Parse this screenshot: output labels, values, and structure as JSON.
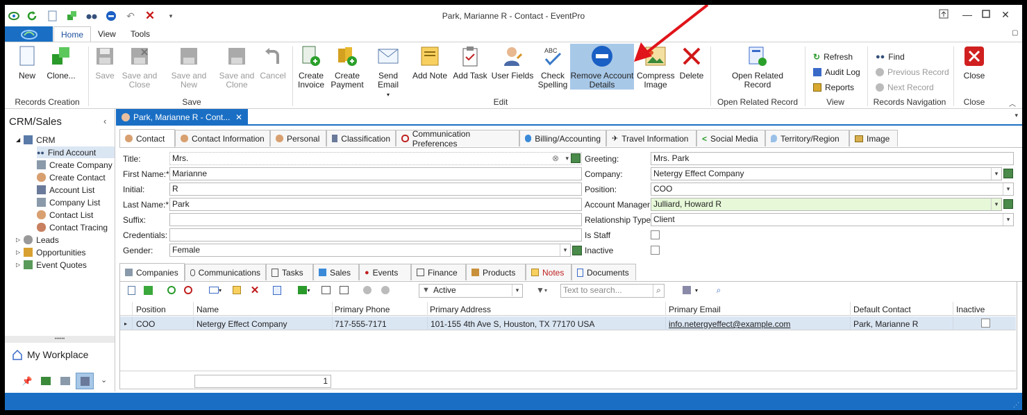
{
  "window": {
    "title": "Park, Marianne R - Contact - EventPro",
    "controls": [
      "restore-app-icon",
      "minimize-icon",
      "maximize-icon",
      "close-icon"
    ]
  },
  "ribbon_tabs": [
    {
      "label": "Home",
      "active": true
    },
    {
      "label": "View"
    },
    {
      "label": "Tools"
    }
  ],
  "ribbon": {
    "records_creation": {
      "group": "Records Creation",
      "new": "New",
      "clone": "Clone..."
    },
    "save": {
      "group": "Save",
      "save": "Save",
      "save_close_1": "Save and",
      "save_close_2": "Close",
      "save_new": "Save and New",
      "save_clone_1": "Save and",
      "save_clone_2": "Clone",
      "cancel": "Cancel"
    },
    "edit": {
      "group": "Edit",
      "create_invoice_1": "Create",
      "create_invoice_2": "Invoice",
      "create_payment_1": "Create",
      "create_payment_2": "Payment",
      "send_email": "Send Email",
      "add_note": "Add Note",
      "add_task": "Add Task",
      "user_fields": "User Fields",
      "check_spelling_1": "Check",
      "check_spelling_2": "Spelling",
      "remove_account_1": "Remove Account",
      "remove_account_2": "Details",
      "compress_image_1": "Compress",
      "compress_image_2": "Image",
      "delete": "Delete"
    },
    "open_related": {
      "group": "Open Related Record",
      "label_1": "Open Related",
      "label_2": "Record"
    },
    "view": {
      "group": "View",
      "refresh": "Refresh",
      "audit_log": "Audit Log",
      "reports": "Reports"
    },
    "navigation": {
      "group": "Records Navigation",
      "find": "Find",
      "previous": "Previous Record",
      "next": "Next Record"
    },
    "close": {
      "group": "Close",
      "close": "Close"
    },
    "highlight_color": "#a8c8e8",
    "annotation_arrow_color": "#e0141a"
  },
  "nav": {
    "title": "CRM/Sales",
    "crm": "CRM",
    "items": [
      {
        "label": "Find Account",
        "selected": true
      },
      {
        "label": "Create Company"
      },
      {
        "label": "Create Contact"
      },
      {
        "label": "Account List"
      },
      {
        "label": "Company List"
      },
      {
        "label": "Contact List"
      },
      {
        "label": "Contact Tracing"
      }
    ],
    "groups": [
      "Leads",
      "Opportunities",
      "Event Quotes"
    ],
    "splitter": "••••••",
    "workplace": "My Workplace"
  },
  "doc_tab": {
    "label": "Park, Marianne R - Cont..."
  },
  "contact_tabs": [
    {
      "label": "Contact",
      "active": true
    },
    {
      "label": "Contact Information"
    },
    {
      "label": "Personal"
    },
    {
      "label": "Classification"
    },
    {
      "label": "Communication Preferences"
    },
    {
      "label": "Billing/Accounting"
    },
    {
      "label": "Travel Information"
    },
    {
      "label": "Social Media"
    },
    {
      "label": "Territory/Region"
    },
    {
      "label": "Image"
    }
  ],
  "form": {
    "title": {
      "label": "Title:",
      "value": "Mrs."
    },
    "first_name": {
      "label": "First Name:*",
      "value": "Marianne"
    },
    "initial": {
      "label": "Initial:",
      "value": "R"
    },
    "last_name": {
      "label": "Last Name:*",
      "value": "Park"
    },
    "suffix": {
      "label": "Suffix:",
      "value": ""
    },
    "credentials": {
      "label": "Credentials:",
      "value": ""
    },
    "gender": {
      "label": "Gender:",
      "value": "Female"
    },
    "greeting": {
      "label": "Greeting:",
      "value": "Mrs. Park"
    },
    "company": {
      "label": "Company:",
      "value": "Netergy Effect Company"
    },
    "position": {
      "label": "Position:",
      "value": "COO"
    },
    "account_manager": {
      "label": "Account Manager:",
      "value": "Julliard, Howard R"
    },
    "relationship_type": {
      "label": "Relationship Type:",
      "value": "Client"
    },
    "is_staff": {
      "label": "Is Staff",
      "checked": false
    },
    "inactive": {
      "label": "Inactive",
      "checked": false
    }
  },
  "sub_tabs": [
    {
      "label": "Companies",
      "active": true
    },
    {
      "label": "Communications"
    },
    {
      "label": "Tasks"
    },
    {
      "label": "Sales"
    },
    {
      "label": "Events"
    },
    {
      "label": "Finance"
    },
    {
      "label": "Products"
    },
    {
      "label": "Notes"
    },
    {
      "label": "Documents"
    }
  ],
  "grid_toolbar": {
    "filter_value": "Active",
    "search_placeholder": "Text to search..."
  },
  "grid": {
    "columns": [
      "Position",
      "Name",
      "Primary Phone",
      "Primary Address",
      "Primary Email",
      "Default Contact",
      "Inactive"
    ],
    "rows": [
      {
        "position": "COO",
        "name": "Netergy Effect Company",
        "phone": "717-555-7171",
        "address": "101-155 4th Ave S, Houston, TX 77170 USA",
        "email": "info.netergyeffect@example.com",
        "default_contact": "Park, Marianne R",
        "inactive": false
      }
    ],
    "count": "1"
  },
  "colors": {
    "accent": "#1a6fc4",
    "highlight_field": "#e6f8d8"
  }
}
